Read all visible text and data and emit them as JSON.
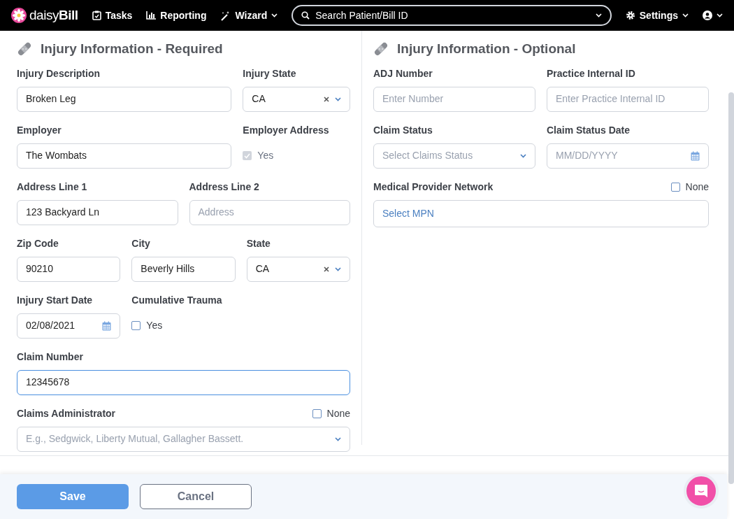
{
  "nav": {
    "logo": "daisy**Bill**",
    "items": [
      {
        "label": "Tasks",
        "caret": false
      },
      {
        "label": "Reporting",
        "caret": false
      },
      {
        "label": "Wizard",
        "caret": true
      }
    ],
    "search": {
      "placeholder": "Search Patient/Bill ID"
    },
    "right": [
      {
        "label": "Settings"
      }
    ]
  },
  "required": {
    "title": "Injury Information - Required",
    "rows": [
      [
        {
          "label": "Injury Description",
          "kind": "text",
          "value": "Broken Leg"
        },
        {
          "label": "Injury State",
          "kind": "select",
          "value": "CA"
        }
      ],
      [
        {
          "label": "Employer",
          "kind": "text",
          "value": "The Wombats"
        },
        {
          "label": "Employer Address",
          "kind": "checkbox",
          "option": "Yes",
          "checked": true,
          "disabled": true
        }
      ],
      [
        {
          "label": "Address Line 1",
          "kind": "text",
          "value": "123 Backyard Ln"
        },
        {
          "label": "Address Line 2",
          "kind": "text",
          "placeholder": "Address"
        }
      ],
      [
        {
          "label": "Zip Code",
          "kind": "text",
          "value": "90210"
        },
        {
          "label": "City",
          "kind": "text",
          "value": "Beverly Hills"
        },
        {
          "label": "State",
          "kind": "select",
          "value": "CA"
        }
      ],
      [
        {
          "label": "Injury Start Date",
          "kind": "date",
          "value": "02/08/2021"
        },
        {
          "label": "Cumulative Trauma",
          "kind": "checkbox",
          "option": "Yes",
          "checked": false,
          "disabled": false
        }
      ],
      [
        {
          "label": "Claim Number",
          "kind": "text",
          "value": "12345678",
          "focused": true
        }
      ],
      [
        {
          "label": "Claims Administrator",
          "kind": "select",
          "placeholder": "E.g., Sedgwick, Liberty Mutual, Gallagher Bassett.",
          "none_option": {
            "label": "None",
            "checked": false
          }
        }
      ]
    ]
  },
  "optional": {
    "title": "Injury Information - Optional",
    "rows": [
      [
        {
          "label": "ADJ Number",
          "kind": "text",
          "placeholder": "Enter Number"
        },
        {
          "label": "Practice Internal ID",
          "kind": "text",
          "placeholder": "Enter Practice Internal ID"
        }
      ],
      [
        {
          "label": "Claim Status",
          "kind": "select",
          "placeholder": "Select Claims Status"
        },
        {
          "label": "Claim Status Date",
          "kind": "date",
          "placeholder": "MM/DD/YYYY"
        }
      ],
      [
        {
          "label": "Medical Provider Network",
          "kind": "picker",
          "value": "Select MPN",
          "none_option": {
            "label": "None",
            "checked": false
          }
        }
      ]
    ]
  },
  "footer": {
    "buttons": [
      {
        "label": "Save",
        "kind": "primary"
      },
      {
        "label": "Cancel",
        "kind": "secondary"
      }
    ]
  }
}
